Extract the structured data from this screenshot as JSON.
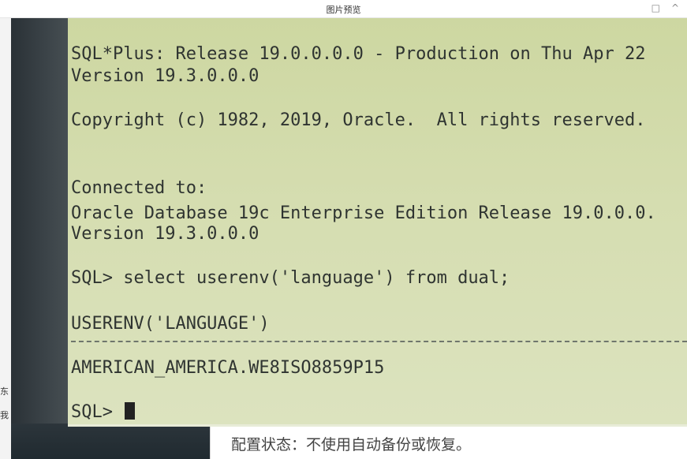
{
  "window": {
    "title": "图片预览",
    "minimize_glyph": "□",
    "collapse_glyph": "^"
  },
  "terminal": {
    "lines": [
      "SQL*Plus: Release 19.0.0.0.0 - Production on Thu Apr 22",
      "Version 19.3.0.0.0",
      "Copyright (c) 1982, 2019, Oracle.  All rights reserved.",
      "Connected to:",
      "Oracle Database 19c Enterprise Edition Release 19.0.0.0.",
      "Version 19.3.0.0.0",
      "SQL> select userenv('language') from dual;",
      "USERENV('LANGUAGE')",
      "AMERICAN_AMERICA.WE8ISO8859P15"
    ],
    "prompt": "SQL>",
    "colors": {
      "screen": "#d3dbab",
      "text": "#2f3431"
    }
  },
  "status": {
    "text": "配置状态：不使用自动备份或恢复。"
  },
  "side_fragments": [
    "东",
    "我"
  ]
}
